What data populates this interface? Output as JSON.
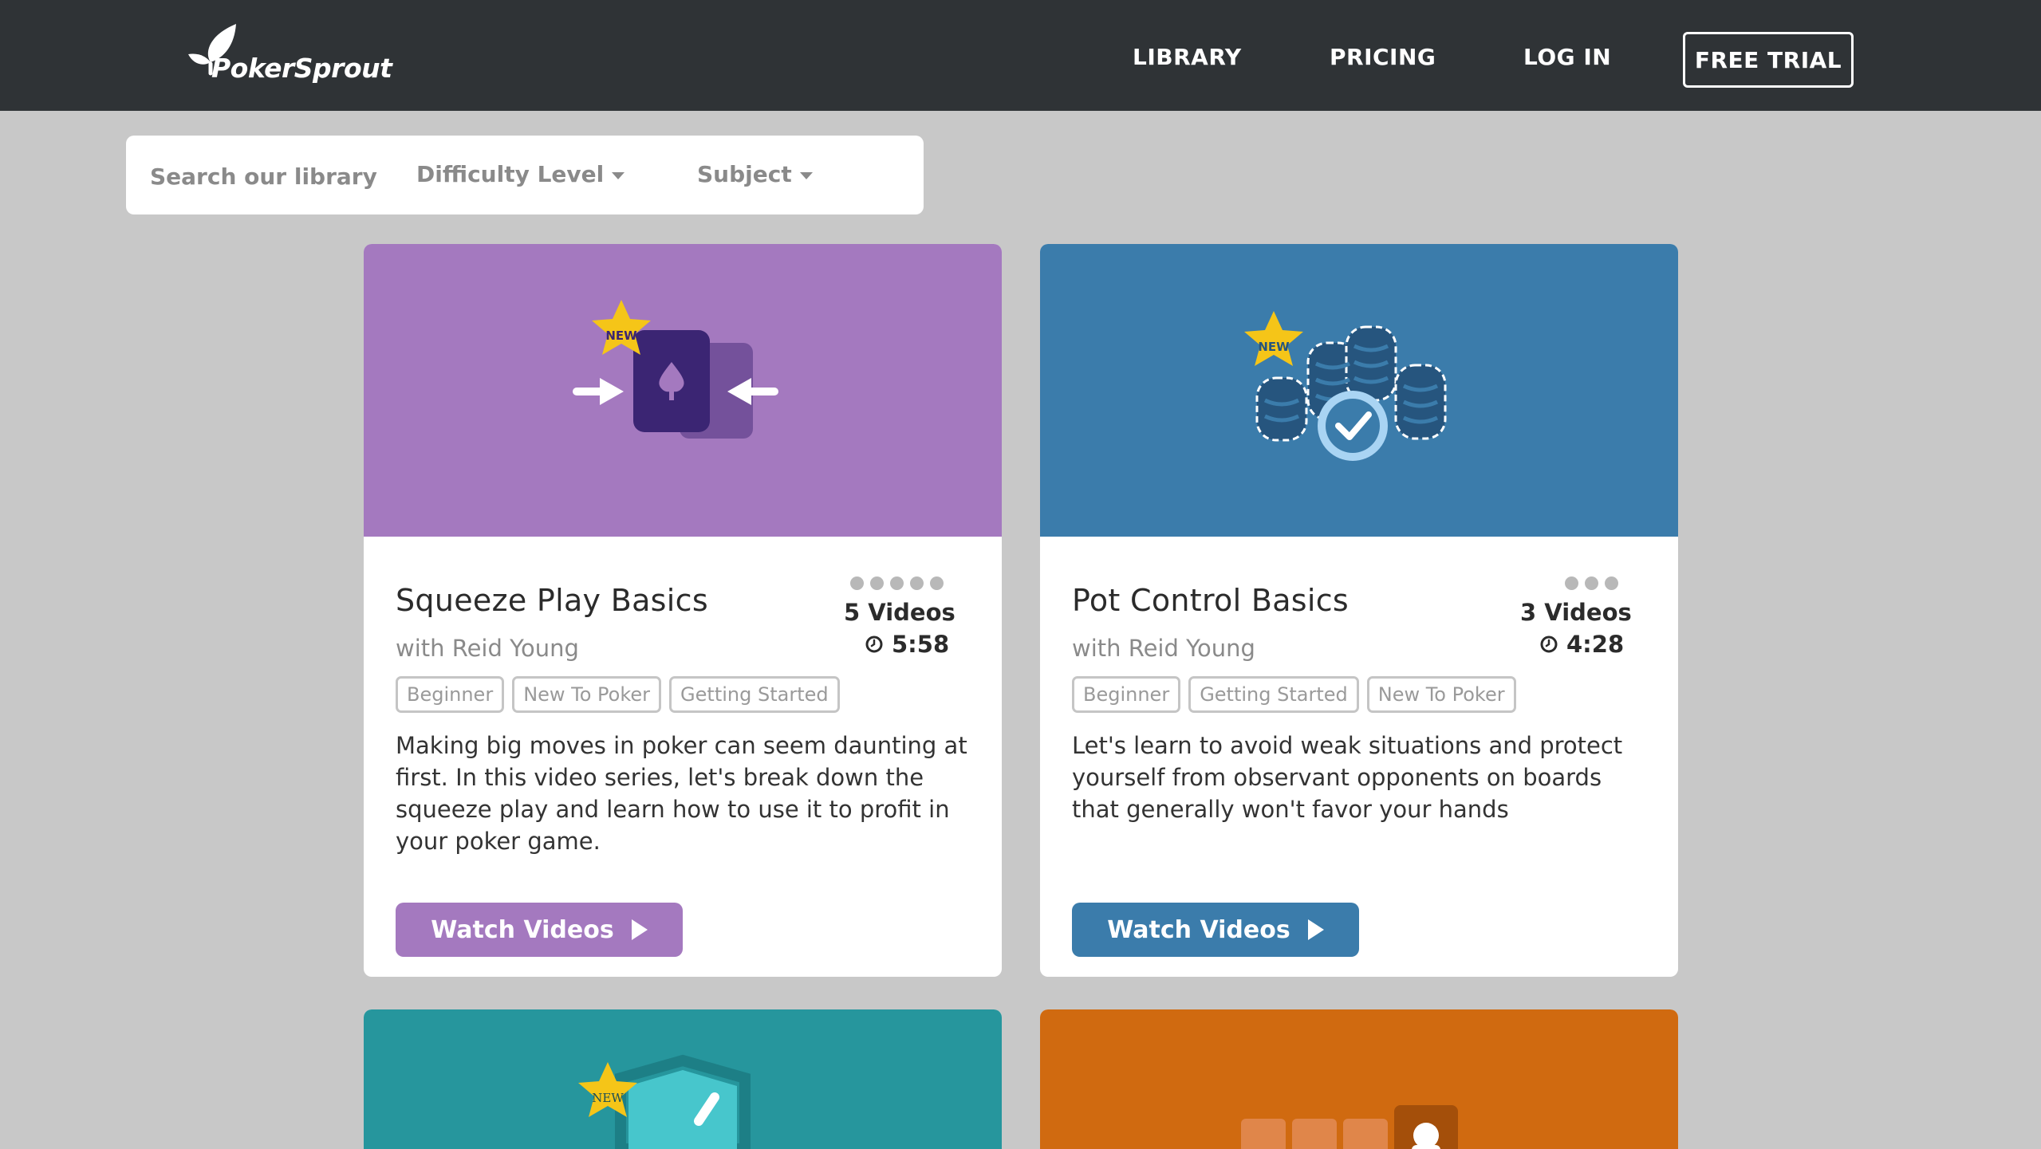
{
  "brand": {
    "name": "PokerSprout"
  },
  "nav": {
    "links": [
      "LIBRARY",
      "PRICING",
      "LOG IN"
    ],
    "trial_button": "FREE TRIAL"
  },
  "search": {
    "placeholder": "Search our library",
    "difficulty_label": "Difficulty Level",
    "subject_label": "Subject"
  },
  "colors": {
    "nav_bg": "#2f3336",
    "page_bg": "#c8c8c8",
    "purple": "#a479bf",
    "blue": "#3b7cab",
    "teal": "#26969d",
    "orange": "#d06a10"
  },
  "cards": [
    {
      "title": "Squeeze Play Basics",
      "author": "with Reid Young",
      "dot_count": 5,
      "videos": "5 Videos",
      "duration": "5:58",
      "tags": [
        "Beginner",
        "New To Poker",
        "Getting Started"
      ],
      "description": "Making big moves in poker can seem daunting at first. In this video series, let's break down the squeeze play and learn how to use it to profit in your poker game.",
      "button": "Watch Videos",
      "badge": "NEW",
      "icon": "squeeze-card-icon"
    },
    {
      "title": "Pot Control Basics",
      "author": "with Reid Young",
      "dot_count": 3,
      "videos": "3 Videos",
      "duration": "4:28",
      "tags": [
        "Beginner",
        "Getting Started",
        "New To Poker"
      ],
      "description": "Let's learn to avoid weak situations and protect yourself from observant opponents on boards that generally won't favor your hands",
      "button": "Watch Videos",
      "badge": "NEW",
      "icon": "chip-stacks-icon"
    },
    {
      "badge": "NEW",
      "icon": "shield-icon"
    },
    {
      "icon": "player-seats-icon"
    }
  ]
}
